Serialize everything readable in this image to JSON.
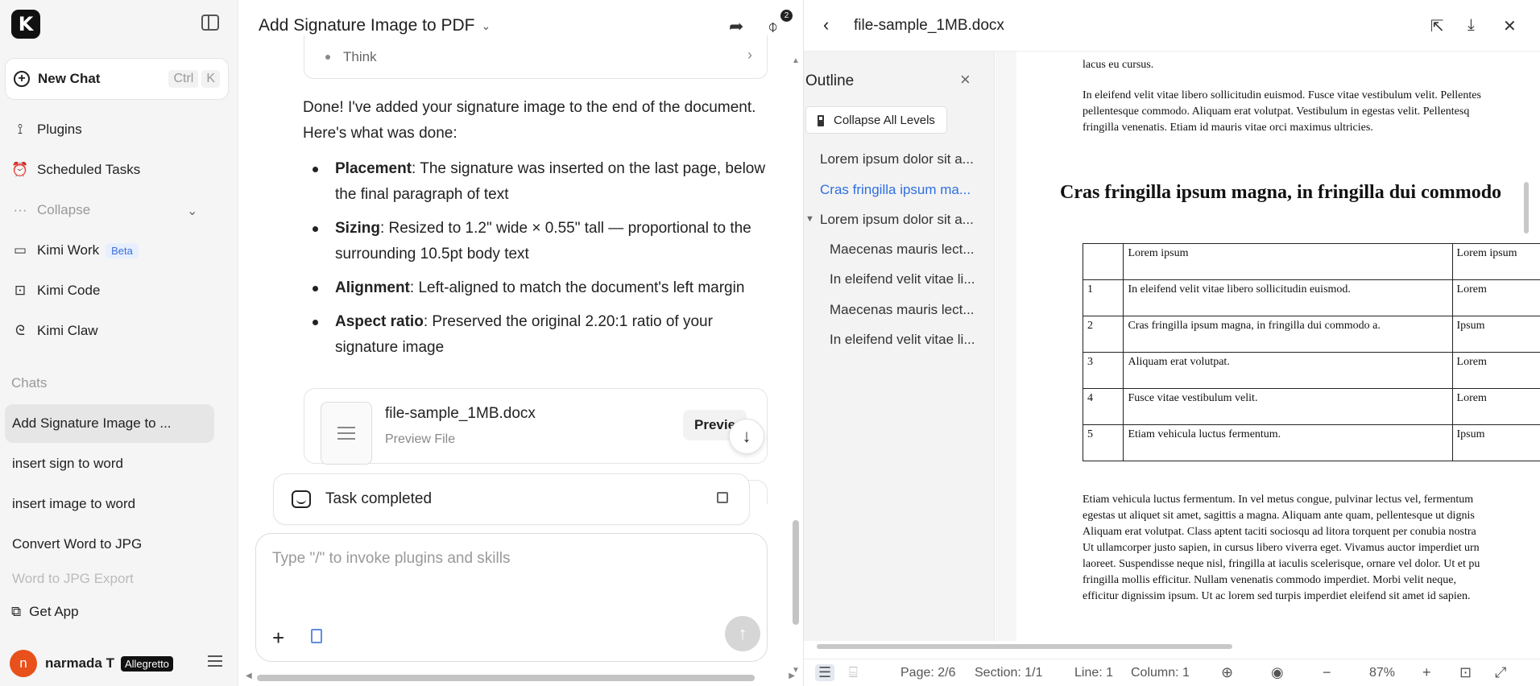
{
  "sidebar": {
    "logo": "K",
    "new_chat": {
      "label": "New Chat",
      "shortcut_ctrl": "Ctrl",
      "shortcut_key": "K"
    },
    "nav": [
      {
        "label": "Plugins",
        "icon": "plug-icon"
      },
      {
        "label": "Scheduled Tasks",
        "icon": "alarm-clock-icon"
      },
      {
        "label": "Collapse",
        "icon": "more-dots-icon"
      },
      {
        "label": "Kimi Work",
        "icon": "monitor-icon",
        "badge": "Beta"
      },
      {
        "label": "Kimi Code",
        "icon": "terminal-icon"
      },
      {
        "label": "Kimi Claw",
        "icon": "claw-icon"
      }
    ],
    "chats_label": "Chats",
    "chats": [
      "Add Signature Image to ...",
      "insert sign to word",
      "insert image to word",
      "Convert Word to JPG",
      "Word to JPG Export"
    ],
    "get_app": "Get App",
    "user": {
      "avatar_letter": "n",
      "name": "narmada T",
      "plan": "Allegretto"
    }
  },
  "chat": {
    "title": "Add Signature Image to PDF",
    "attachment_count": "2",
    "think_label": "Think",
    "intro": "Done! I've added your signature image to the end of the document. Here's what was done:",
    "bullets": [
      {
        "term": "Placement",
        "text": ": The signature was inserted on the last page, below the final paragraph of text"
      },
      {
        "term": "Sizing",
        "text": ": Resized to 1.2\" wide × 0.55\" tall — proportional to the surrounding 10.5pt body text"
      },
      {
        "term": "Alignment",
        "text": ": Left-aligned to match the document's left margin"
      },
      {
        "term": "Aspect ratio",
        "text": ": Preserved the original 2.20:1 ratio of your signature image"
      }
    ],
    "file_card": {
      "name": "file-sample_1MB.docx",
      "sub": "Preview File",
      "preview_btn": "Previe"
    },
    "task": "Task completed",
    "input_placeholder": "Type \"/\" to invoke plugins and skills"
  },
  "preview": {
    "title": "file-sample_1MB.docx",
    "outline": {
      "title": "Outline",
      "collapse_btn": "Collapse All Levels",
      "items": [
        {
          "label": "Lorem ipsum dolor sit a...",
          "level": 1,
          "active": false
        },
        {
          "label": "Cras fringilla ipsum ma...",
          "level": 1,
          "active": true
        },
        {
          "label": "Lorem ipsum dolor sit a...",
          "level": 1,
          "active": false,
          "expanded": true
        },
        {
          "label": "Maecenas mauris lect...",
          "level": 2,
          "active": false
        },
        {
          "label": "In eleifend velit vitae li...",
          "level": 2,
          "active": false
        },
        {
          "label": "Maecenas mauris lect...",
          "level": 2,
          "active": false
        },
        {
          "label": "In eleifend velit vitae li...",
          "level": 2,
          "active": false
        }
      ]
    },
    "document": {
      "top_lines": [
        "lacus eu cursus.",
        "In eleifend velit vitae libero sollicitudin euismod. Fusce vitae vestibulum velit. Pellentes",
        "pellentesque commodo. Aliquam erat volutpat. Vestibulum in egestas velit. Pellentesq",
        "fringilla venenatis. Etiam id mauris vitae orci maximus ultricies."
      ],
      "heading": "Cras fringilla ipsum magna, in fringilla dui commodo",
      "table": {
        "header": [
          "",
          "Lorem ipsum",
          "Lorem ipsum"
        ],
        "rows": [
          [
            "1",
            "In eleifend velit vitae libero sollicitudin euismod.",
            "Lorem"
          ],
          [
            "2",
            "Cras fringilla ipsum magna, in fringilla dui commodo a.",
            "Ipsum"
          ],
          [
            "3",
            "Aliquam erat volutpat.",
            "Lorem"
          ],
          [
            "4",
            "Fusce vitae vestibulum velit.",
            "Lorem"
          ],
          [
            "5",
            "Etiam vehicula luctus fermentum.",
            "Ipsum"
          ]
        ]
      },
      "bottom_lines": [
        "Etiam vehicula luctus fermentum. In vel metus congue, pulvinar lectus vel, fermentum",
        "egestas ut aliquet sit amet, sagittis a magna. Aliquam ante quam, pellentesque ut dignis",
        "Aliquam erat volutpat. Class aptent taciti sociosqu ad litora torquent per conubia nostra",
        "Ut ullamcorper justo sapien, in cursus libero viverra eget. Vivamus auctor imperdiet urn",
        "laoreet. Suspendisse neque nisl, fringilla at iaculis scelerisque, ornare vel dolor. Ut et pu",
        "fringilla mollis efficitur. Nullam venenatis commodo imperdiet. Morbi velit neque,",
        "efficitur dignissim ipsum. Ut ac lorem sed turpis imperdiet eleifend sit amet id sapien."
      ]
    },
    "status": {
      "page": "Page: 2/6",
      "section": "Section: 1/1",
      "line": "Line: 1",
      "column": "Column: 1",
      "zoom": "87%"
    }
  },
  "colors": {
    "accent": "#2f6fe0",
    "avatar": "#e8501c",
    "beta_bg": "#e7efff"
  }
}
